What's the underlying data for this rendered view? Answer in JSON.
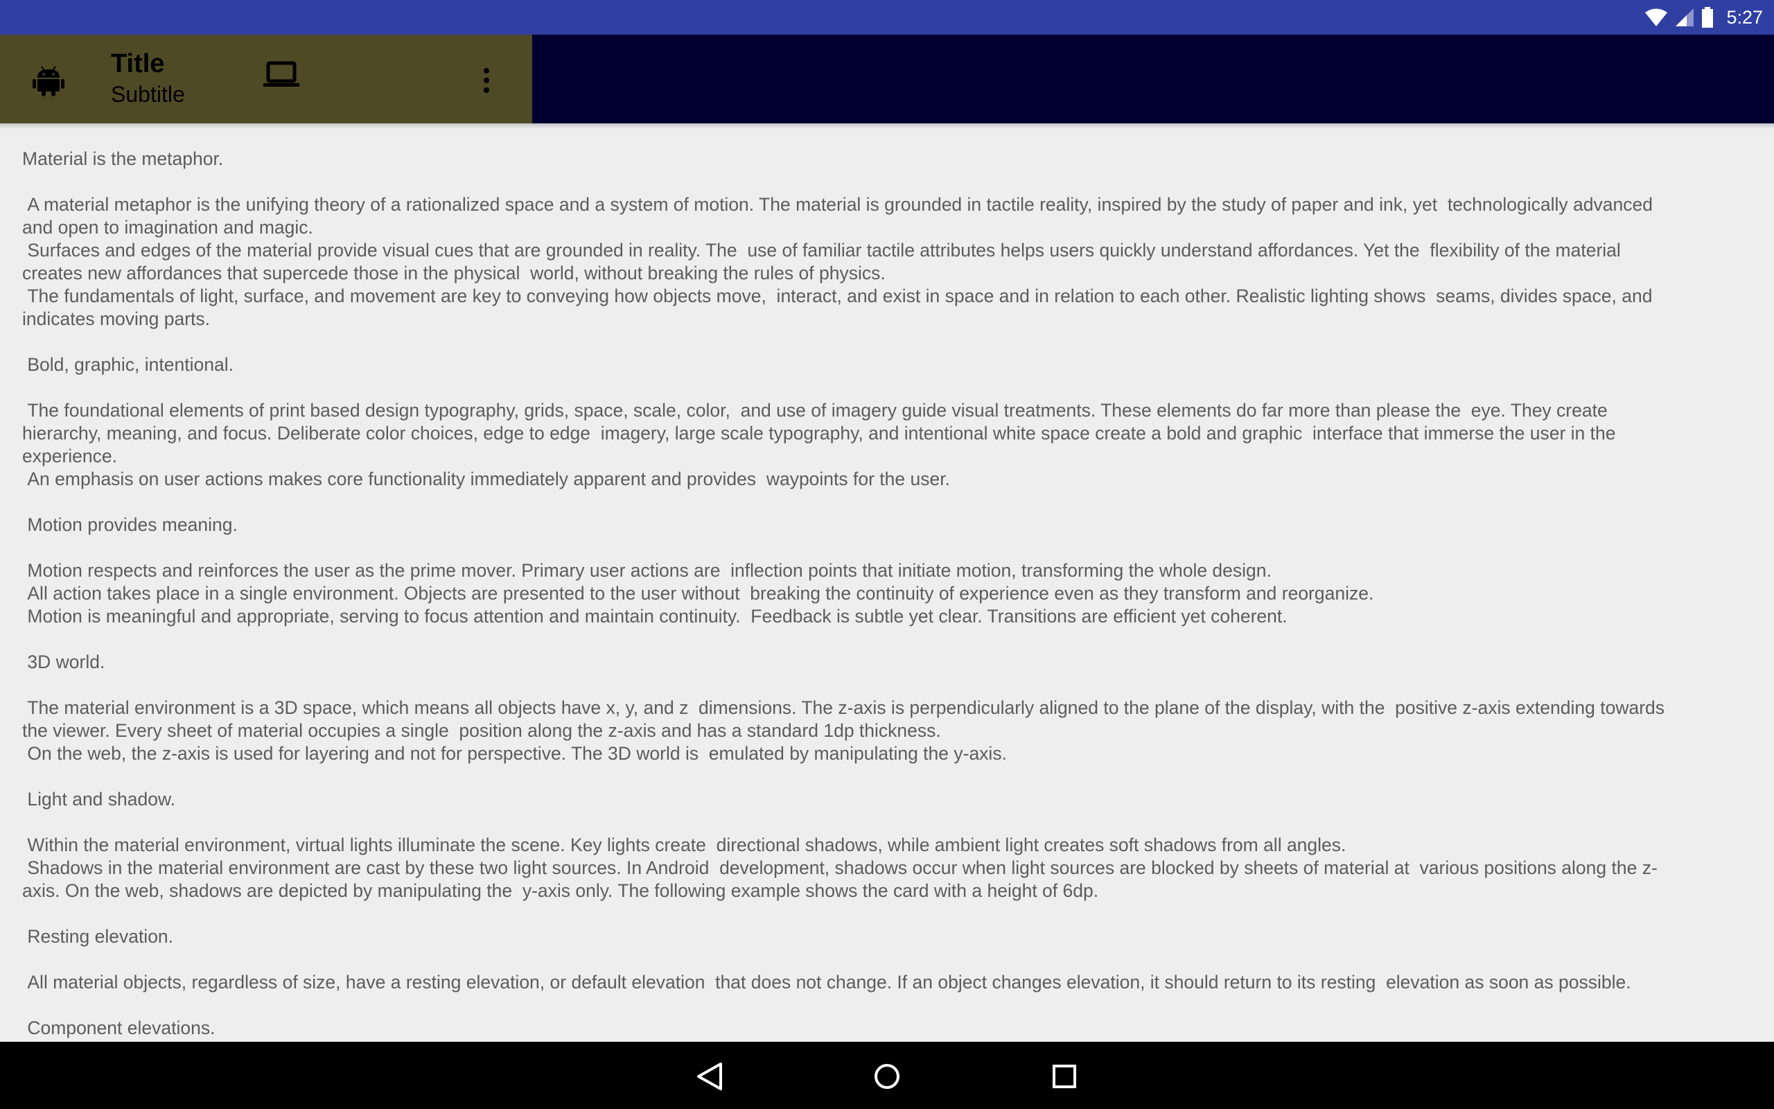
{
  "status_bar": {
    "time": "5:27",
    "icons": [
      "wifi-icon",
      "cell-signal-icon",
      "battery-icon"
    ],
    "background": "#303fa2"
  },
  "toolbar": {
    "title": "Title",
    "subtitle": "Subtitle",
    "background": "#4e4a26",
    "extension_background": "#000030",
    "icons": [
      "android-icon",
      "laptop-icon",
      "overflow-menu-icon"
    ]
  },
  "content": {
    "lines": [
      "Material is the metaphor.",
      "",
      " A material metaphor is the unifying theory of a rationalized space and a system of motion. The material is grounded in tactile reality, inspired by the study of paper and ink, yet  technologically advanced",
      "and open to imagination and magic.",
      " Surfaces and edges of the material provide visual cues that are grounded in reality. The  use of familiar tactile attributes helps users quickly understand affordances. Yet the  flexibility of the material",
      "creates new affordances that supercede those in the physical  world, without breaking the rules of physics.",
      " The fundamentals of light, surface, and movement are key to conveying how objects move,  interact, and exist in space and in relation to each other. Realistic lighting shows  seams, divides space, and",
      "indicates moving parts.",
      "",
      " Bold, graphic, intentional.",
      "",
      " The foundational elements of print based design typography, grids, space, scale, color,  and use of imagery guide visual treatments. These elements do far more than please the  eye. They create",
      "hierarchy, meaning, and focus. Deliberate color choices, edge to edge  imagery, large scale typography, and intentional white space create a bold and graphic  interface that immerse the user in the",
      "experience.",
      " An emphasis on user actions makes core functionality immediately apparent and provides  waypoints for the user.",
      "",
      " Motion provides meaning.",
      "",
      " Motion respects and reinforces the user as the prime mover. Primary user actions are  inflection points that initiate motion, transforming the whole design.",
      " All action takes place in a single environment. Objects are presented to the user without  breaking the continuity of experience even as they transform and reorganize.",
      " Motion is meaningful and appropriate, serving to focus attention and maintain continuity.  Feedback is subtle yet clear. Transitions are efficient yet coherent.",
      "",
      " 3D world.",
      "",
      " The material environment is a 3D space, which means all objects have x, y, and z  dimensions. The z-axis is perpendicularly aligned to the plane of the display, with the  positive z-axis extending towards",
      "the viewer. Every sheet of material occupies a single  position along the z-axis and has a standard 1dp thickness.",
      " On the web, the z-axis is used for layering and not for perspective. The 3D world is  emulated by manipulating the y-axis.",
      "",
      " Light and shadow.",
      "",
      " Within the material environment, virtual lights illuminate the scene. Key lights create  directional shadows, while ambient light creates soft shadows from all angles.",
      " Shadows in the material environment are cast by these two light sources. In Android  development, shadows occur when light sources are blocked by sheets of material at  various positions along the z-",
      "axis. On the web, shadows are depicted by manipulating the  y-axis only. The following example shows the card with a height of 6dp.",
      "",
      " Resting elevation.",
      "",
      " All material objects, regardless of size, have a resting elevation, or default elevation  that does not change. If an object changes elevation, it should return to its resting  elevation as soon as possible.",
      "",
      " Component elevations."
    ]
  },
  "nav_bar": {
    "buttons": [
      "back-icon",
      "home-icon",
      "recents-icon"
    ]
  }
}
